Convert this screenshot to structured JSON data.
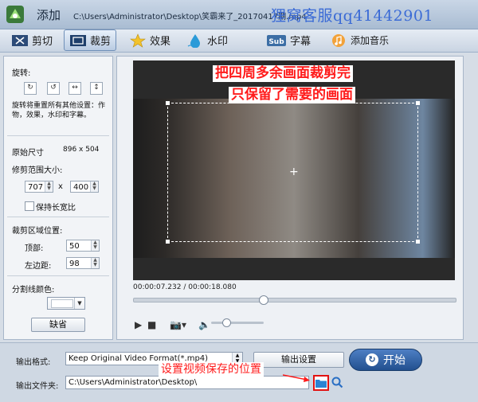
{
  "titlebar": {
    "title": "添加",
    "file_path": "C:\\Users\\Administrator\\Desktop\\笑霸来了_20170417期.mp4",
    "watermark": "狸窝客服qq41442901"
  },
  "tabs": [
    {
      "label": "剪切",
      "icon": "scissors-icon"
    },
    {
      "label": "裁剪",
      "icon": "crop-icon",
      "active": true
    },
    {
      "label": "效果",
      "icon": "effects-star-icon"
    },
    {
      "label": "水印",
      "icon": "watermark-drop-icon"
    },
    {
      "label": "字幕",
      "icon": "subtitle-sub-icon"
    },
    {
      "label": "添加音乐",
      "icon": "music-note-icon"
    }
  ],
  "left_panel": {
    "rotate_label": "旋转:",
    "rotate_note": "旋转将重置所有其他设置：作物，效果，水印和字幕。",
    "original_size_label": "原始尺寸",
    "original_size_value": "896 x 504",
    "crop_size_label": "修剪范围大小:",
    "crop_width": "707",
    "crop_x": "x",
    "crop_height": "400",
    "keep_ratio_label": "保持长宽比",
    "crop_position_label": "裁剪区域位置:",
    "top_label": "顶部:",
    "top_value": "50",
    "left_label": "左边距:",
    "left_value": "98",
    "divider_color_label": "分割线颜色:",
    "default_button": "缺省"
  },
  "video": {
    "annotation_line1": "把四周多余画面裁剪完",
    "annotation_line2": "只保留了需要的画面",
    "time_display": "00:00:07.232 / 00:00:18.080",
    "seek_fraction": 0.4
  },
  "bottom": {
    "format_label": "输出格式:",
    "format_value": "Keep Original Video Format(*.mp4)",
    "output_settings_button": "输出设置",
    "start_button": "开始",
    "folder_label": "输出文件夹:",
    "folder_value": "C:\\Users\\Administrator\\Desktop\\",
    "annotation": "设置视频保存的位置"
  },
  "colors": {
    "annotation_red": "#ff1b1b",
    "start_blue": "#22508f",
    "watermark_blue": "#3b6bd6"
  }
}
